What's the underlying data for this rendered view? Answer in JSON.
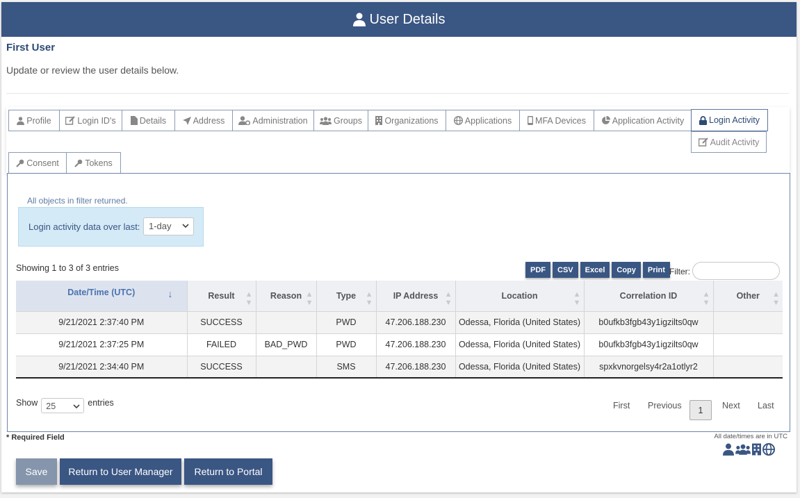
{
  "header": {
    "title": "User Details"
  },
  "user": {
    "name": "First User",
    "subtitle": "Update or review the user details below."
  },
  "tabs": {
    "profile": "Profile",
    "login_ids": "Login ID's",
    "details": "Details",
    "address": "Address",
    "administration": "Administration",
    "groups": "Groups",
    "organizations": "Organizations",
    "applications": "Applications",
    "mfa_devices": "MFA Devices",
    "application_activity": "Application Activity",
    "login_activity": "Login Activity",
    "audit_activity": "Audit Activity",
    "consent": "Consent",
    "tokens": "Tokens"
  },
  "panel": {
    "filter_note": "All objects in filter returned.",
    "range_label": "Login activity data over last:",
    "range_value": "1-day",
    "showing": "Showing 1 to 3 of 3 entries",
    "export": [
      "PDF",
      "CSV",
      "Excel",
      "Copy",
      "Print"
    ],
    "filter_label": "Filter:"
  },
  "table": {
    "columns": [
      "Date/Time (UTC)",
      "Result",
      "Reason",
      "Type",
      "IP Address",
      "Location",
      "Correlation ID",
      "Other"
    ],
    "rows": [
      [
        "9/21/2021 2:37:40 PM",
        "SUCCESS",
        "",
        "PWD",
        "47.206.188.230",
        "Odessa, Florida (United States)",
        "b0ufkb3fgb43y1igzilts0qw",
        ""
      ],
      [
        "9/21/2021 2:37:25 PM",
        "FAILED",
        "BAD_PWD",
        "PWD",
        "47.206.188.230",
        "Odessa, Florida (United States)",
        "b0ufkb3fgb43y1igzilts0qw",
        ""
      ],
      [
        "9/21/2021 2:34:40 PM",
        "SUCCESS",
        "",
        "SMS",
        "47.206.188.230",
        "Odessa, Florida (United States)",
        "spxkvnorgelsy4r2a1otlyr2",
        ""
      ]
    ]
  },
  "entries": {
    "show": "Show",
    "value": "25",
    "suffix": "entries"
  },
  "pager": {
    "first": "First",
    "previous": "Previous",
    "current": "1",
    "next": "Next",
    "last": "Last"
  },
  "footer": {
    "required": "* Required Field",
    "utc_note": "All date/times are in UTC",
    "save": "Save",
    "return_user_manager": "Return to User Manager",
    "return_portal": "Return to Portal"
  },
  "colors": {
    "brand": "#3a5683",
    "disabled": "#8595ac",
    "info_bg": "#d4eaf6"
  }
}
